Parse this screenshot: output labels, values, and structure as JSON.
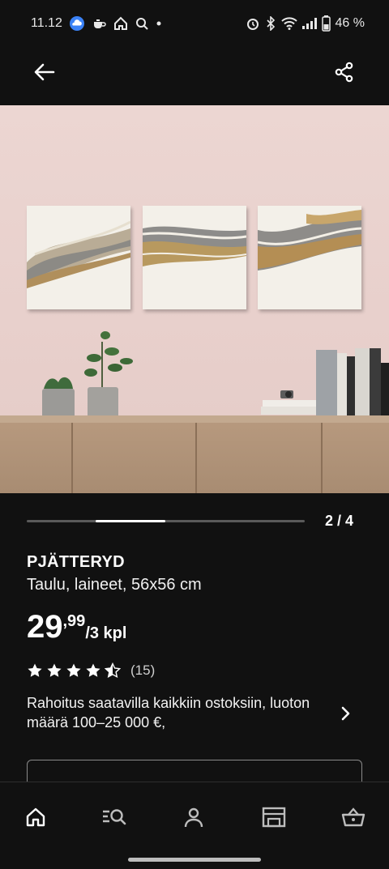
{
  "status_bar": {
    "time": "11.12",
    "battery": "46 %",
    "icons": [
      "cloud-icon",
      "teapot-icon",
      "home-app-icon",
      "search-icon",
      "dot-icon",
      "alarm-icon",
      "bluetooth-icon",
      "wifi-icon",
      "signal-icon",
      "battery-icon"
    ]
  },
  "app_bar": {
    "back_icon": "arrow-left-icon",
    "share_icon": "share-icon"
  },
  "gallery": {
    "counter": "2 / 4",
    "current": 2,
    "total": 4
  },
  "product": {
    "name": "PJÄTTERYD",
    "description": "Taulu, laineet, 56x56 cm",
    "price_integer": "29",
    "price_decimal": ",99",
    "price_unit": "/3 kpl",
    "rating": 4.5,
    "rating_max": 5,
    "review_count": "(15)"
  },
  "financing": {
    "text": "Rahoitus saatavilla kaikkiin ostoksiin, luoton määrä 100–25 000 €,"
  },
  "bottom_nav": {
    "items": [
      "home-icon",
      "search-list-icon",
      "profile-icon",
      "store-icon",
      "basket-icon"
    ],
    "active": "home-icon"
  },
  "colors": {
    "background": "#111111",
    "text": "#ffffff",
    "wall": "#e8cfcb",
    "cabinet": "#b89a7f"
  }
}
